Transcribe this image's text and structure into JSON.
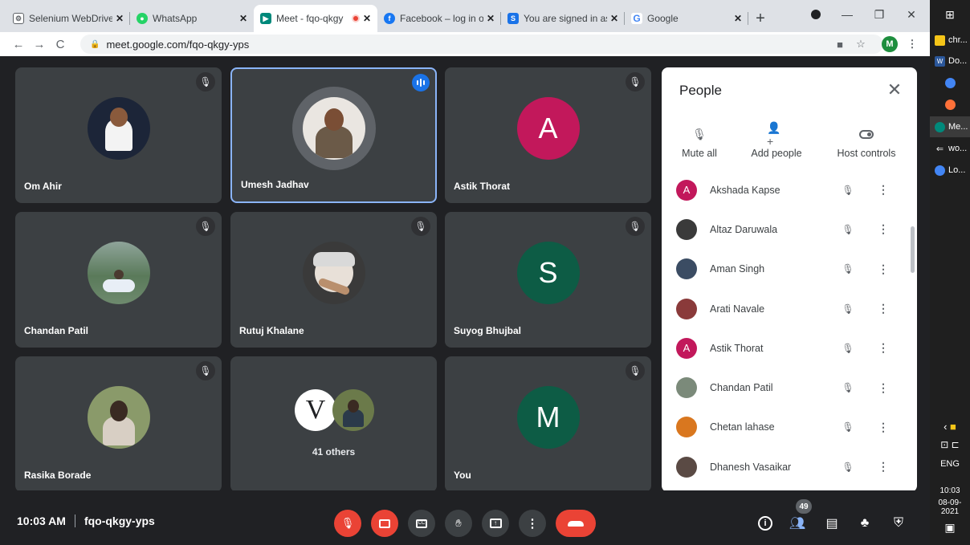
{
  "browser": {
    "tabs": [
      {
        "title": "Selenium WebDriver",
        "icon": "selenium-icon",
        "color": "#ffffff",
        "active": false
      },
      {
        "title": "WhatsApp",
        "icon": "whatsapp-icon",
        "color": "#25d366",
        "active": false
      },
      {
        "title": "Meet - fqo-qkgy",
        "icon": "meet-icon",
        "color": "#00897b",
        "active": true
      },
      {
        "title": "Facebook – log in or",
        "icon": "facebook-icon",
        "color": "#1877f2",
        "active": false
      },
      {
        "title": "You are signed in as",
        "icon": "s-icon",
        "color": "#1a73e8",
        "active": false
      },
      {
        "title": "Google",
        "icon": "google-icon",
        "color": "#4285f4",
        "active": false
      }
    ],
    "fav_letters": {
      "fb": "f",
      "s": "S",
      "g": "G"
    },
    "url": "meet.google.com/fqo-qkgy-yps",
    "profile_initial": "M"
  },
  "tiles": [
    {
      "name": "Om Ahir",
      "avatar": "photo",
      "photo_color": "#2d3a55"
    },
    {
      "name": "Umesh Jadhav",
      "avatar": "photo",
      "photo_color": "#6b5a48",
      "speaking": true
    },
    {
      "name": "Astik Thorat",
      "avatar": "letter",
      "letter": "A",
      "color": "#c2185b"
    },
    {
      "name": "Chandan Patil",
      "avatar": "photo",
      "photo_color": "#6f8a7a"
    },
    {
      "name": "Rutuj Khalane",
      "avatar": "photo",
      "photo_color": "#4a4a4a"
    },
    {
      "name": "Suyog Bhujbal",
      "avatar": "letter",
      "letter": "S",
      "color": "#0d5c45"
    },
    {
      "name": "Rasika Borade",
      "avatar": "photo",
      "photo_color": "#7a8a52"
    },
    {
      "name": "",
      "others": true,
      "label": "41 others",
      "v_letter": "V"
    },
    {
      "name": "You",
      "avatar": "letter",
      "letter": "M",
      "color": "#0d5c45"
    }
  ],
  "people_panel": {
    "title": "People",
    "actions": [
      {
        "label": "Mute all",
        "icon": "mic-off-icon"
      },
      {
        "label": "Add people",
        "icon": "add-person-icon"
      },
      {
        "label": "Host controls",
        "icon": "toggle-icon"
      }
    ],
    "participants": [
      {
        "name": "Akshada Kapse",
        "avatar": "letter",
        "letter": "A",
        "color": "#c2185b"
      },
      {
        "name": "Altaz Daruwala",
        "avatar": "photo",
        "color": "#3a3a3a"
      },
      {
        "name": "Aman Singh",
        "avatar": "photo",
        "color": "#3b4c63"
      },
      {
        "name": "Arati Navale",
        "avatar": "photo",
        "color": "#8a3a3a"
      },
      {
        "name": "Astik Thorat",
        "avatar": "letter",
        "letter": "A",
        "color": "#c2185b"
      },
      {
        "name": "Chandan Patil",
        "avatar": "photo",
        "color": "#7b8a7a"
      },
      {
        "name": "Chetan lahase",
        "avatar": "photo",
        "color": "#d9771f"
      },
      {
        "name": "Dhanesh Vasaikar",
        "avatar": "photo",
        "color": "#5a4a44"
      }
    ]
  },
  "bottom": {
    "time": "10:03 AM",
    "meeting_code": "fqo-qkgy-yps",
    "people_count": "49"
  },
  "taskbar": {
    "items": [
      {
        "label": "chr...",
        "color": "#f5c518"
      },
      {
        "label": "Do...",
        "color": "#2b579a",
        "letter": "W"
      },
      {
        "label": "",
        "color": "#4285f4"
      },
      {
        "label": "",
        "color": "#ff7139"
      },
      {
        "label": "Me...",
        "color": "#00897b",
        "selected": true
      },
      {
        "label": "wo...",
        "color": "#9aa0a6"
      },
      {
        "label": "Lo...",
        "color": "#4285f4"
      }
    ],
    "lang": "ENG",
    "clock_time": "10:03",
    "clock_date": "08-09-2021"
  }
}
